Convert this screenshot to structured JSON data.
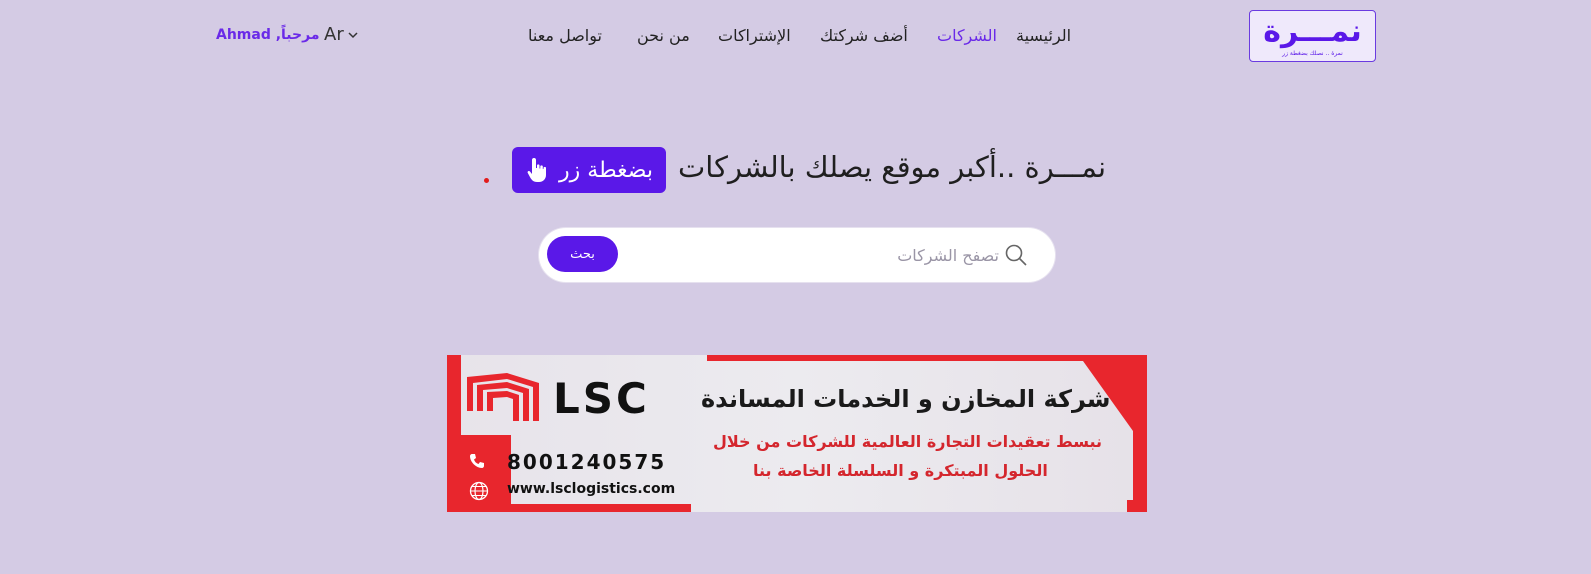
{
  "brand": {
    "logo_text": "نمـــرة",
    "logo_tagline": "نمرة .. نصلك بضغطة زر"
  },
  "nav": {
    "items": [
      {
        "label": "الرئيسية"
      },
      {
        "label": "الشركات"
      },
      {
        "label": "أضف شركتك"
      },
      {
        "label": "الإشتراكات"
      },
      {
        "label": "من نحن"
      },
      {
        "label": "تواصل معنا"
      }
    ],
    "active_index": 1
  },
  "lang": {
    "label": "Ar"
  },
  "user": {
    "greeting": "مرحباً, Ahmad"
  },
  "hero": {
    "headline": "نمـــرة ..أكبر موقع يصلك بالشركات",
    "button_label": "بضغطة زر"
  },
  "search": {
    "placeholder": "تصفح الشركات",
    "button_label": "بحث"
  },
  "banner": {
    "brand": "LSC",
    "title": "شركة المخازن و الخدمات المساندة",
    "line1": "نبسط تعقيدات التجارة العالمية للشركات من خلال",
    "line2": "الحلول المبتكرة و السلسلة  الخاصة بنا",
    "phone": "8001240575",
    "website": "www.lsclogistics.com"
  },
  "colors": {
    "background": "#d4cbe4",
    "accent": "#5a18e8",
    "banner_red": "#e8262d"
  }
}
